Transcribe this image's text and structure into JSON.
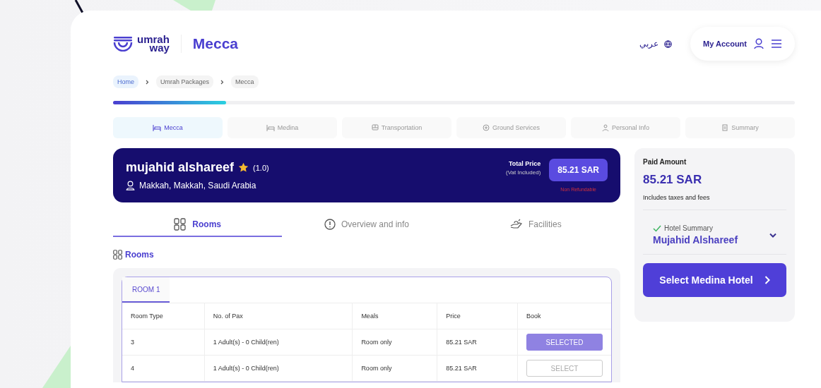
{
  "header": {
    "logo": {
      "line1": "umrah",
      "line2": "way"
    },
    "city": "Mecca",
    "language": "عربي",
    "account": "My Account"
  },
  "breadcrumb": [
    {
      "label": "Home",
      "selected": true
    },
    {
      "label": "Umrah Packages",
      "selected": false
    },
    {
      "label": "Mecca",
      "selected": false
    }
  ],
  "progress": {
    "level": 0.166
  },
  "steps": [
    {
      "label": "Mecca",
      "selected": true
    },
    {
      "label": "Medina",
      "selected": false
    },
    {
      "label": "Transportation",
      "selected": false
    },
    {
      "label": "Ground Services",
      "selected": false
    },
    {
      "label": "Personal Info",
      "selected": false
    },
    {
      "label": "Summary",
      "selected": false
    }
  ],
  "hotel": {
    "name": "mujahid alshareef",
    "rating": "(1.0)",
    "location": "Makkah, Makkah, Saudi Arabia",
    "total_label": "Total Price",
    "vat_note": "(Vat Included)",
    "price": "85.21 SAR",
    "refund_note": "Non Refundable"
  },
  "content_tabs": [
    {
      "label": "Rooms",
      "selected": true
    },
    {
      "label": "Overview and info",
      "selected": false
    },
    {
      "label": "Facilities",
      "selected": false
    }
  ],
  "section_title": "Rooms",
  "room_tabs": [
    {
      "label": "ROOM 1",
      "selected": true
    }
  ],
  "table": {
    "columns": [
      "Room Type",
      "No. of Pax",
      "Meals",
      "Price",
      "Book"
    ],
    "rows": [
      {
        "room_type": "3",
        "pax": "1 Adult(s) - 0 Child(ren)",
        "meals": "Room only",
        "price": "85.21 SAR",
        "button": "SELECTED",
        "selected": true
      },
      {
        "room_type": "4",
        "pax": "1 Adult(s) - 0 Child(ren)",
        "meals": "Room only",
        "price": "85.21 SAR",
        "button": "SELECT",
        "selected": false
      }
    ]
  },
  "summary": {
    "paid_label": "Paid Amount",
    "paid_amount": "85.21 SAR",
    "tax_note": "Includes taxes and fees",
    "hotel_label": "Hotel Summary",
    "hotel_name": "Mujahid Alshareef",
    "button": "Select Medina Hotel"
  }
}
